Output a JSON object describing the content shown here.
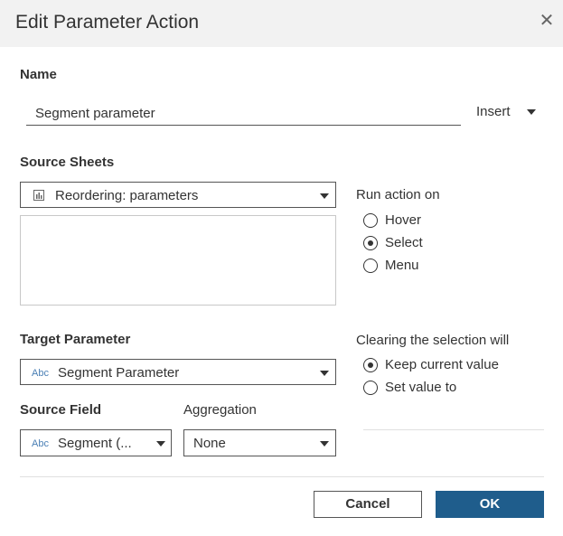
{
  "dialog": {
    "title": "Edit Parameter Action",
    "close_icon": "close-icon"
  },
  "name": {
    "label": "Name",
    "value": "Segment parameter",
    "insert_label": "Insert"
  },
  "source_sheets": {
    "label": "Source Sheets",
    "selected": "Reordering: parameters",
    "selected_icon": "sheet-bar-chart-icon",
    "list_items": []
  },
  "run_action": {
    "label": "Run action on",
    "options": [
      "Hover",
      "Select",
      "Menu"
    ],
    "selected": "Select"
  },
  "target_parameter": {
    "label": "Target Parameter",
    "type_badge": "Abc",
    "selected": "Segment Parameter"
  },
  "source_field": {
    "label": "Source Field",
    "type_badge": "Abc",
    "selected": "Segment (..."
  },
  "aggregation": {
    "label": "Aggregation",
    "selected": "None"
  },
  "clearing": {
    "label": "Clearing the selection will",
    "options": [
      "Keep current value",
      "Set value to"
    ],
    "selected": "Keep current value"
  },
  "buttons": {
    "cancel": "Cancel",
    "ok": "OK"
  },
  "colors": {
    "accent": "#1f5d8c",
    "title_bar": "#f2f2f2"
  }
}
